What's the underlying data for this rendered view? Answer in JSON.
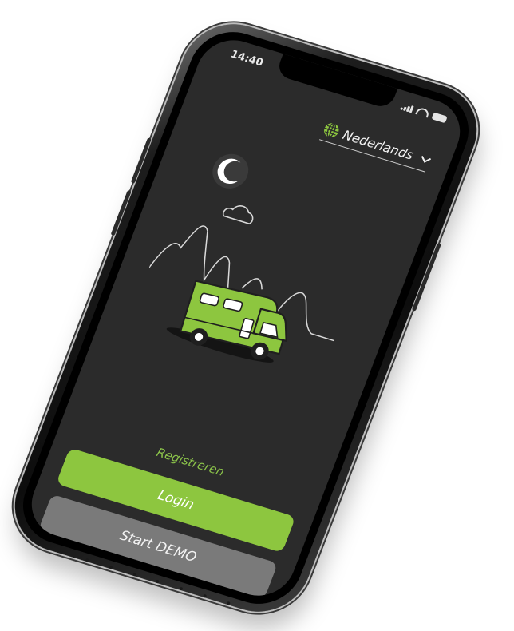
{
  "status_bar": {
    "time": "14:40"
  },
  "language_selector": {
    "label": "Nederlands",
    "icon": "globe-icon"
  },
  "illustration": {
    "icon": "camper-night-illustration"
  },
  "actions": {
    "register_label": "Registreren",
    "login_label": "Login",
    "demo_label": "Start DEMO"
  },
  "colors": {
    "accent": "#8dc63f",
    "screen_bg": "#2b2b2b",
    "demo_button": "#7a7a7a"
  }
}
